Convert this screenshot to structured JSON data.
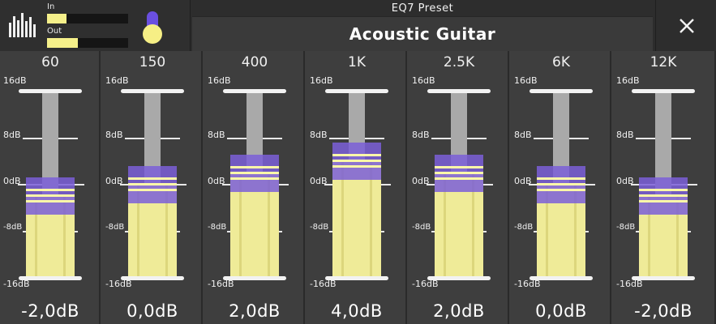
{
  "header": {
    "meter_icon": "equalizer-bars-icon",
    "in_label": "In",
    "out_label": "Out",
    "in_level": 0.24,
    "out_level": 0.38,
    "preset_caption": "EQ7 Preset",
    "preset_name": "Acoustic Guitar",
    "close_icon": "close-icon"
  },
  "scale": {
    "top": "16dB",
    "upper": "8dB",
    "zero": "0dB",
    "lower": "-8dB",
    "bottom": "-16dB"
  },
  "bands": [
    {
      "freq": "60",
      "value": "-2,0dB",
      "db": -2
    },
    {
      "freq": "150",
      "value": "0,0dB",
      "db": 0
    },
    {
      "freq": "400",
      "value": "2,0dB",
      "db": 2
    },
    {
      "freq": "1K",
      "value": "4,0dB",
      "db": 4
    },
    {
      "freq": "2.5K",
      "value": "2,0dB",
      "db": 2
    },
    {
      "freq": "6K",
      "value": "0,0dB",
      "db": 0
    },
    {
      "freq": "12K",
      "value": "-2,0dB",
      "db": -2
    }
  ],
  "colors": {
    "accent_purple": "#7b5fd8",
    "fill_yellow": "#efeb98",
    "background": "#3e3e3e"
  }
}
